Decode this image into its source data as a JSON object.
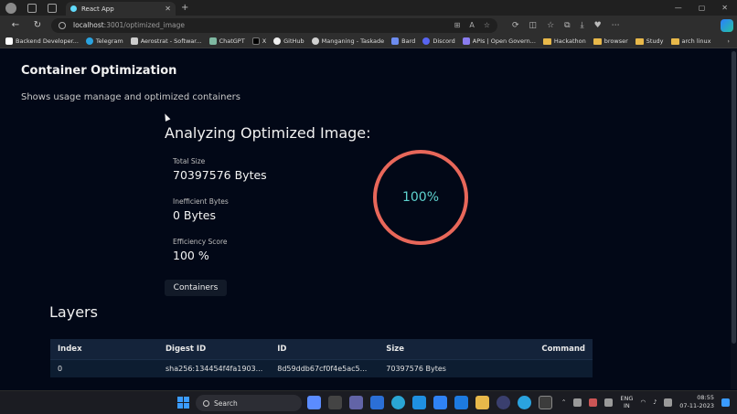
{
  "browser": {
    "tab_title": "React App",
    "url_host": "localhost",
    "url_path": ":3001/optimized_image",
    "bookmarks": [
      "Backend Developer...",
      "Telegram",
      "Aerostrat - Softwar...",
      "ChatGPT",
      "X",
      "GitHub",
      "Manganing - Taskade",
      "Bard",
      "Discord",
      "APIs | Open Govern...",
      "Hackathon",
      "browser",
      "Study",
      "arch linux"
    ]
  },
  "page": {
    "title": "Container Optimization",
    "subtitle": "Shows usage manage and optimized containers",
    "analyze_title": "Analyzing Optimized Image:",
    "stats": {
      "total_size_label": "Total Size",
      "total_size_value": "70397576 Bytes",
      "inefficient_label": "Inefficient Bytes",
      "inefficient_value": "0 Bytes",
      "efficiency_label": "Efficiency Score",
      "efficiency_value": "100 %"
    },
    "progress": {
      "label": "100%",
      "fraction": 1.0,
      "color": "#e8675a"
    },
    "containers_button": "Containers",
    "layers_title": "Layers",
    "table": {
      "headers": [
        "Index",
        "Digest ID",
        "ID",
        "Size",
        "Command"
      ],
      "rows": [
        [
          "0",
          "sha256:134454f4fa1903...",
          "8d59ddb67cf0f4e5ac5...",
          "70397576 Bytes",
          ""
        ]
      ]
    }
  },
  "taskbar": {
    "search_label": "Search",
    "lang_top": "ENG",
    "lang_bottom": "IN",
    "time": "08:55",
    "date": "07-11-2023"
  }
}
